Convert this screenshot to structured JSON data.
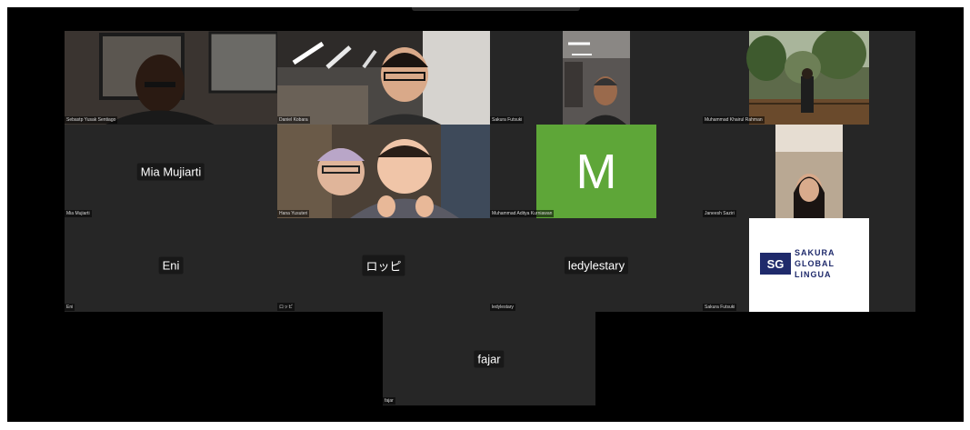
{
  "participants": [
    {
      "display_name": "",
      "tag": "Sebastp Yusak Sentiago"
    },
    {
      "display_name": "",
      "tag": "Daniel Kobara"
    },
    {
      "display_name": "",
      "tag": "Sakura Futsuki"
    },
    {
      "display_name": "",
      "tag": "Muhammad Khairul Rahman"
    },
    {
      "display_name": "Mia Mujiarti",
      "tag": "Mia Mujiarti"
    },
    {
      "display_name": "",
      "tag": "Hana Yusuteri"
    },
    {
      "display_name": "M",
      "tag": "Muhammad Aditya Kurniawan"
    },
    {
      "display_name": "",
      "tag": "Janeesh Saziri"
    },
    {
      "display_name": "Eni",
      "tag": "Eni"
    },
    {
      "display_name": "ロッピ",
      "tag": "ロッピ"
    },
    {
      "display_name": "ledylestary",
      "tag": "ledylestary"
    },
    {
      "display_name": "",
      "tag": "Sakura Futsuki"
    },
    {
      "display_name": "fajar",
      "tag": "fajar"
    }
  ],
  "logo": {
    "mark": "SG",
    "line1": "SAKURA",
    "line2": "GLOBAL",
    "line3": "LINGUA"
  },
  "colors": {
    "background": "#000000",
    "tile": "#262626",
    "avatar_green": "#5ea638",
    "logo_navy": "#1f2a6b"
  }
}
